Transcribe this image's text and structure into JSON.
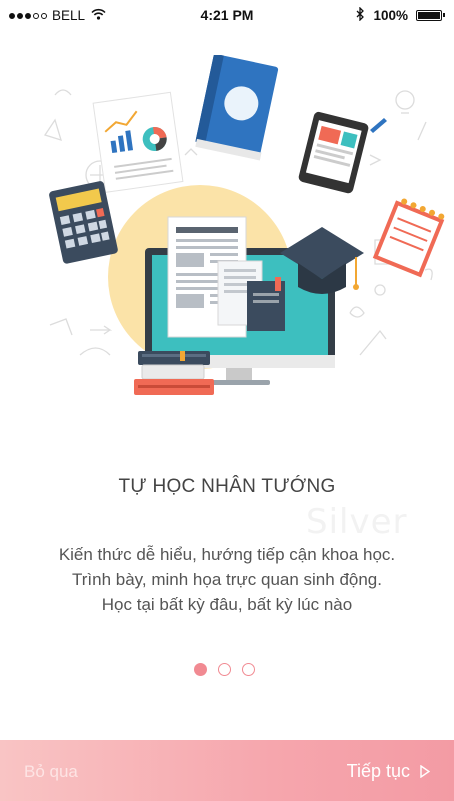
{
  "status_bar": {
    "carrier": "BELL",
    "time": "4:21 PM",
    "battery": "100%",
    "signal_strength_bars": 2,
    "icons": [
      "signal-dots-icon",
      "wifi-icon",
      "bluetooth-icon",
      "battery-icon"
    ]
  },
  "onboarding": {
    "title": "TỰ HỌC NHÂN TƯỚNG",
    "watermark": "Silver",
    "description": [
      "Kiến thức dễ hiểu, hướng tiếp cận khoa học.",
      "Trình bày, minh họa trực quan sinh động.",
      "Học tại bất kỳ đâu, bất kỳ lúc nào"
    ],
    "page_count": 3,
    "current_page": 1
  },
  "bottom_bar": {
    "skip_label": "Bỏ qua",
    "next_label": "Tiếp tục"
  },
  "colors": {
    "accent": "#f18a92",
    "bar_gradient_start": "#f9c4c4",
    "bar_gradient_end": "#f39ba4",
    "circle_bg": "#fbe3a8",
    "monitor_screen": "#3dbfbf",
    "book_blue": "#2f74c0"
  }
}
